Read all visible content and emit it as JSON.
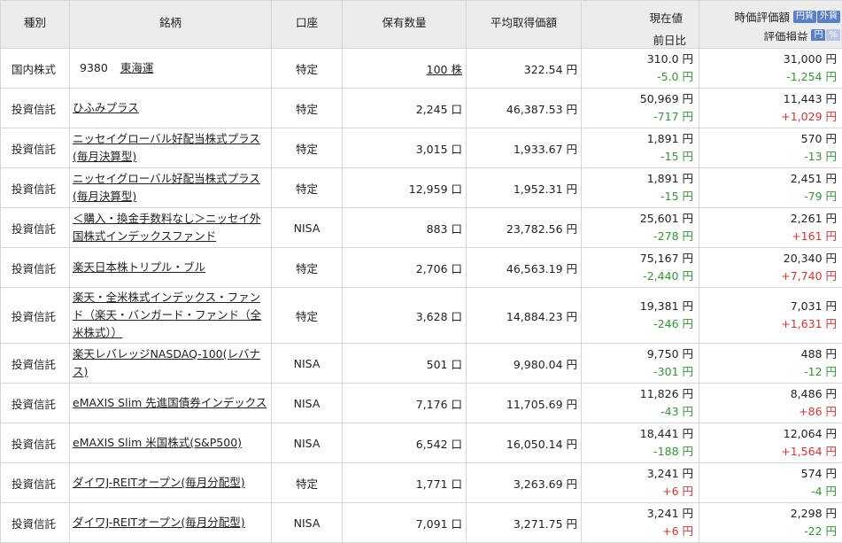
{
  "header": {
    "type": "種別",
    "name": "銘柄",
    "account": "口座",
    "quantity": "保有数量",
    "avg_cost": "平均取得価額",
    "price_line1": "現在値",
    "price_line2": "前日比",
    "value_line1": "時価評価額",
    "value_line2": "評価損益",
    "toggle_currency": [
      "円貨",
      "外貨"
    ],
    "toggle_unit": [
      "円",
      "%"
    ]
  },
  "rows": [
    {
      "type": "国内株式",
      "code": "9380",
      "name": "東海運",
      "account": "特定",
      "qty": "100 株",
      "avg": "322.54 円",
      "price": "310.0 円",
      "change": "-5.0 円",
      "change_dir": "down",
      "value": "31,000 円",
      "pl": "-1,254 円",
      "pl_dir": "down"
    },
    {
      "type": "投資信託",
      "name": "ひふみプラス",
      "account": "特定",
      "qty": "2,245 口",
      "avg": "46,387.53 円",
      "price": "50,969 円",
      "change": "-717 円",
      "change_dir": "down",
      "value": "11,443 円",
      "pl": "+1,029 円",
      "pl_dir": "up"
    },
    {
      "type": "投資信託",
      "name": "ニッセイグローバル好配当株式プラス(毎月決算型)",
      "account": "特定",
      "qty": "3,015 口",
      "avg": "1,933.67 円",
      "price": "1,891 円",
      "change": "-15 円",
      "change_dir": "down",
      "value": "570 円",
      "pl": "-13 円",
      "pl_dir": "down"
    },
    {
      "type": "投資信託",
      "name": "ニッセイグローバル好配当株式プラス(毎月決算型)",
      "account": "特定",
      "qty": "12,959 口",
      "avg": "1,952.31 円",
      "price": "1,891 円",
      "change": "-15 円",
      "change_dir": "down",
      "value": "2,451 円",
      "pl": "-79 円",
      "pl_dir": "down"
    },
    {
      "type": "投資信託",
      "name": "＜購入・換金手数料なし＞ニッセイ外国株式インデックスファンド",
      "account": "NISA",
      "qty": "883 口",
      "avg": "23,782.56 円",
      "price": "25,601 円",
      "change": "-278 円",
      "change_dir": "down",
      "value": "2,261 円",
      "pl": "+161 円",
      "pl_dir": "up"
    },
    {
      "type": "投資信託",
      "name": "楽天日本株トリプル・ブル",
      "account": "特定",
      "qty": "2,706 口",
      "avg": "46,563.19 円",
      "price": "75,167 円",
      "change": "-2,440 円",
      "change_dir": "down",
      "value": "20,340 円",
      "pl": "+7,740 円",
      "pl_dir": "up"
    },
    {
      "type": "投資信託",
      "name": "楽天・全米株式インデックス・ファンド（楽天・バンガード・ファンド（全米株式））",
      "account": "特定",
      "qty": "3,628 口",
      "avg": "14,884.23 円",
      "price": "19,381 円",
      "change": "-246 円",
      "change_dir": "down",
      "value": "7,031 円",
      "pl": "+1,631 円",
      "pl_dir": "up"
    },
    {
      "type": "投資信託",
      "name": "楽天レバレッジNASDAQ-100(レバナス)",
      "account": "NISA",
      "qty": "501 口",
      "avg": "9,980.04 円",
      "price": "9,750 円",
      "change": "-301 円",
      "change_dir": "down",
      "value": "488 円",
      "pl": "-12 円",
      "pl_dir": "down"
    },
    {
      "type": "投資信託",
      "name": "eMAXIS Slim 先進国債券インデックス",
      "account": "NISA",
      "qty": "7,176 口",
      "avg": "11,705.69 円",
      "price": "11,826 円",
      "change": "-43 円",
      "change_dir": "down",
      "value": "8,486 円",
      "pl": "+86 円",
      "pl_dir": "up"
    },
    {
      "type": "投資信託",
      "name": "eMAXIS Slim 米国株式(S&P500)",
      "account": "NISA",
      "qty": "6,542 口",
      "avg": "16,050.14 円",
      "price": "18,441 円",
      "change": "-188 円",
      "change_dir": "down",
      "value": "12,064 円",
      "pl": "+1,564 円",
      "pl_dir": "up"
    },
    {
      "type": "投資信託",
      "name": "ダイワJ-REITオープン(毎月分配型)",
      "account": "特定",
      "qty": "1,771 口",
      "avg": "3,263.69 円",
      "price": "3,241 円",
      "change": "+6 円",
      "change_dir": "up",
      "value": "574 円",
      "pl": "-4 円",
      "pl_dir": "down"
    },
    {
      "type": "投資信託",
      "name": "ダイワJ-REITオープン(毎月分配型)",
      "account": "NISA",
      "qty": "7,091 口",
      "avg": "3,271.75 円",
      "price": "3,241 円",
      "change": "+6 円",
      "change_dir": "up",
      "value": "2,298 円",
      "pl": "-22 円",
      "pl_dir": "down"
    }
  ]
}
